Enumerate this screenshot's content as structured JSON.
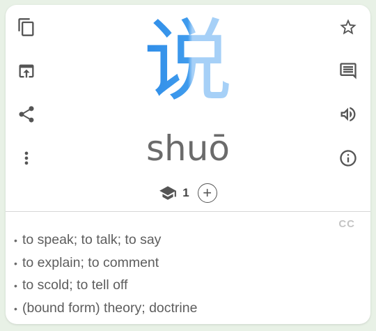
{
  "entry": {
    "character": "说",
    "pinyin": "shuō",
    "level": "1",
    "add_label": "+",
    "source_badge": "CC",
    "definitions": [
      "to speak; to talk; to say",
      "to explain; to comment",
      "to scold; to tell off",
      "(bound form) theory; doctrine"
    ]
  },
  "icons": {
    "left": [
      "copy-icon",
      "open-in-app-icon",
      "share-icon",
      "more-vert-icon"
    ],
    "right": [
      "star-outline-icon",
      "comment-icon",
      "volume-icon",
      "info-icon"
    ],
    "level": "school-cap-icon"
  },
  "colors": {
    "hanzi_primary": "#3f9bed",
    "hanzi_secondary": "#a6d0f7",
    "icon": "#555555",
    "text": "#5d5d5d",
    "background": "#e8f1e6"
  }
}
